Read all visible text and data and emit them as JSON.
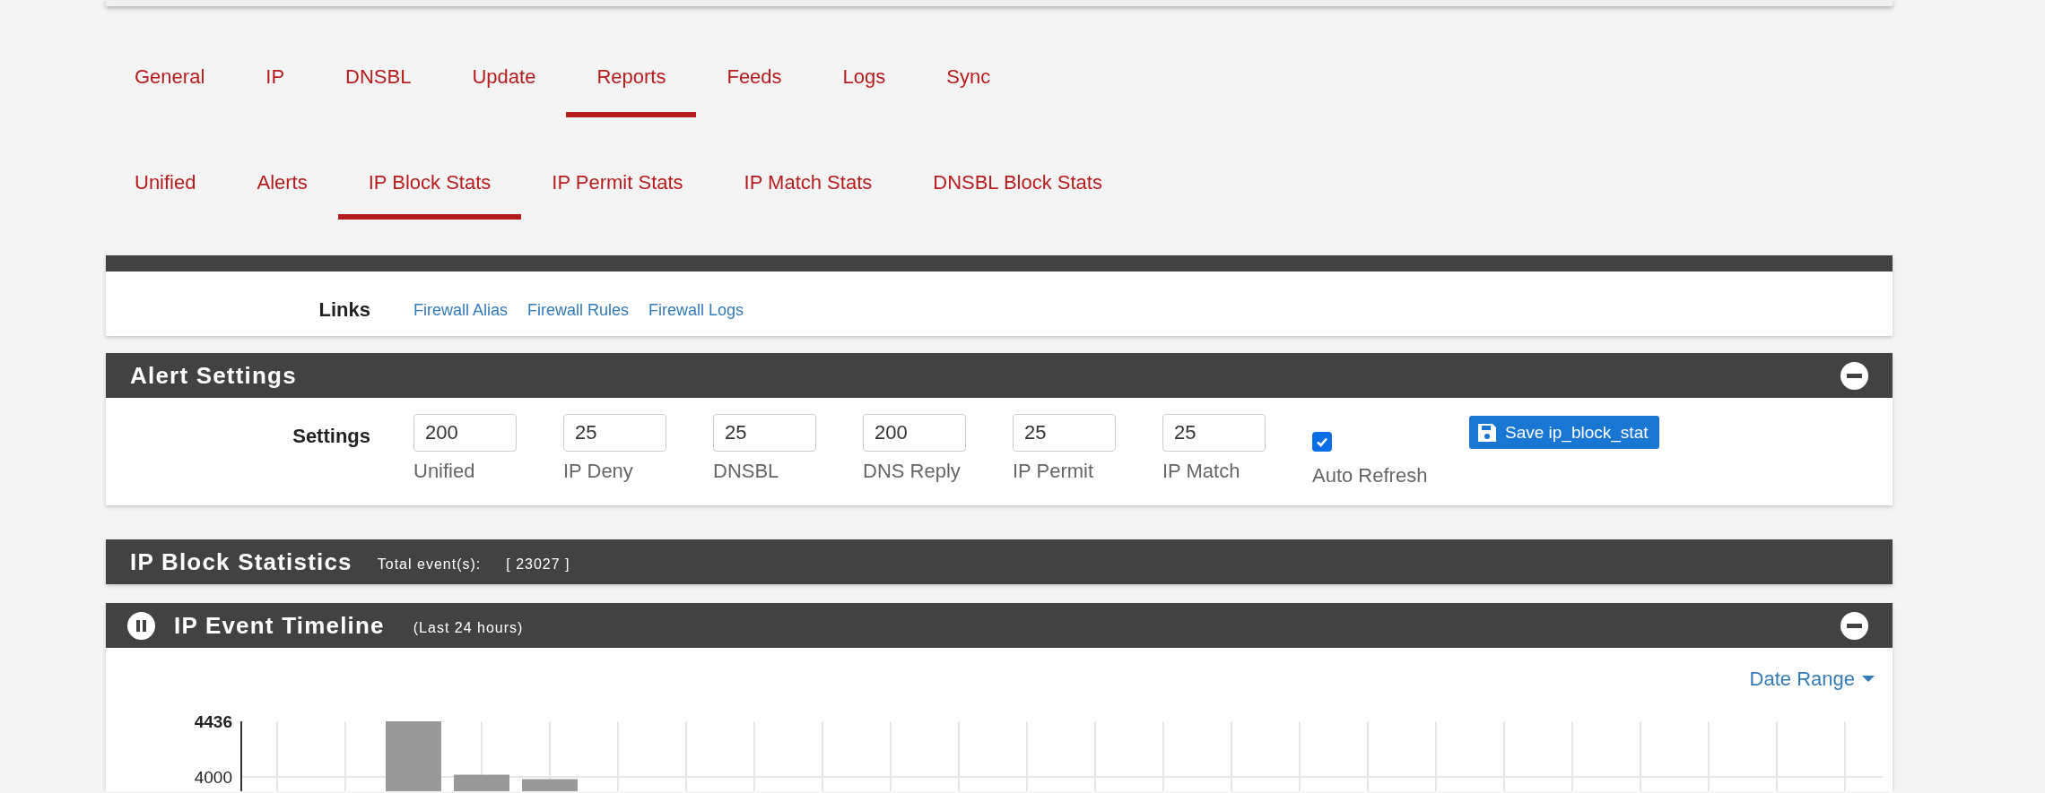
{
  "tabs": [
    {
      "label": "General",
      "selected": false
    },
    {
      "label": "IP",
      "selected": false
    },
    {
      "label": "DNSBL",
      "selected": false
    },
    {
      "label": "Update",
      "selected": false
    },
    {
      "label": "Reports",
      "selected": true
    },
    {
      "label": "Feeds",
      "selected": false
    },
    {
      "label": "Logs",
      "selected": false
    },
    {
      "label": "Sync",
      "selected": false
    }
  ],
  "subtabs": [
    {
      "label": "Unified",
      "selected": false
    },
    {
      "label": "Alerts",
      "selected": false
    },
    {
      "label": "IP Block Stats",
      "selected": true
    },
    {
      "label": "IP Permit Stats",
      "selected": false
    },
    {
      "label": "IP Match Stats",
      "selected": false
    },
    {
      "label": "DNSBL Block Stats",
      "selected": false
    }
  ],
  "links_panel": {
    "label": "Links",
    "links": [
      "Firewall Alias",
      "Firewall Rules",
      "Firewall Logs"
    ]
  },
  "alert_settings": {
    "title": "Alert Settings",
    "label": "Settings",
    "fields": [
      {
        "value": "200",
        "label": "Unified"
      },
      {
        "value": "25",
        "label": "IP Deny"
      },
      {
        "value": "25",
        "label": "DNSBL"
      },
      {
        "value": "200",
        "label": "DNS Reply"
      },
      {
        "value": "25",
        "label": "IP Permit"
      },
      {
        "value": "25",
        "label": "IP Match"
      }
    ],
    "auto_refresh": {
      "label": "Auto Refresh",
      "checked": true
    },
    "save_button": "Save ip_block_stat"
  },
  "statistics": {
    "title": "IP Block Statistics",
    "total_label": "Total event(s):",
    "total_value": "[ 23027 ]"
  },
  "timeline": {
    "title": "IP Event Timeline",
    "subtitle": "(Last 24 hours)",
    "date_range": "Date Range",
    "chart_data": {
      "type": "bar",
      "ylim": [
        3870,
        4436
      ],
      "yticks": [
        4000,
        4436
      ],
      "grid": true,
      "values": [
        null,
        null,
        4436,
        4017,
        3982,
        null,
        null,
        null,
        null,
        null,
        null,
        null,
        null,
        null,
        null,
        null,
        null,
        null,
        null,
        null,
        null,
        null,
        null,
        null
      ]
    }
  }
}
